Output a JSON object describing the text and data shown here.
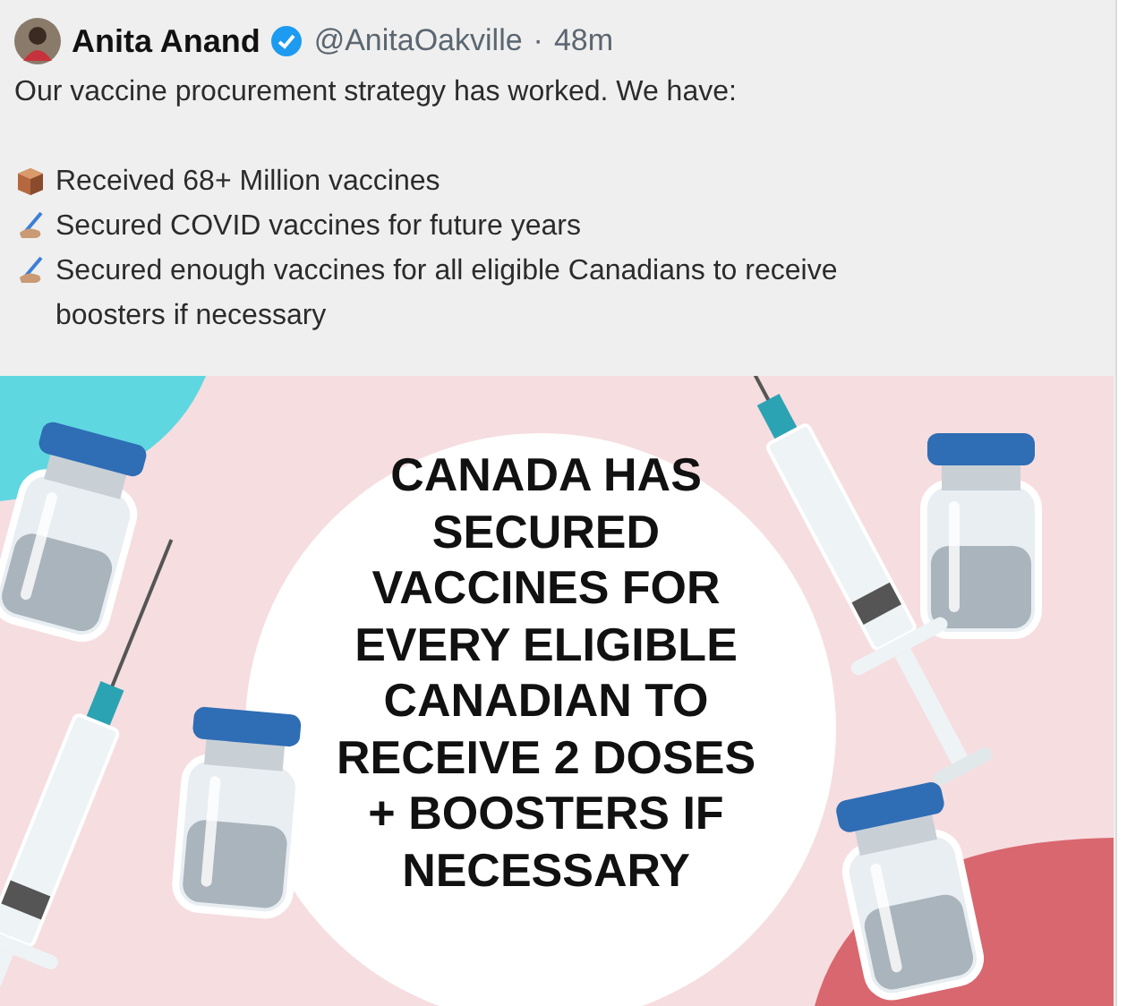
{
  "tweet": {
    "author": "Anita Anand",
    "verified": true,
    "handle": "@AnitaOakville",
    "separator": "·",
    "time": "48m",
    "intro": "Our vaccine procurement strategy has worked. We have:",
    "points": [
      {
        "kind": "package",
        "text": "Received 68+ Million vaccines"
      },
      {
        "kind": "writing",
        "text": "Secured COVID vaccines for future years"
      },
      {
        "kind": "writing",
        "text": "Secured enough vaccines for all eligible Canadians to receive boosters if necessary"
      }
    ],
    "image": {
      "kind": "picture",
      "headline": [
        "CANADA HAS",
        "SECURED",
        "VACCINES FOR",
        "EVERY ELIGIBLE",
        "CANADIAN TO",
        "RECEIVE 2 DOSES",
        "+ BOOSTERS IF",
        "NECESSARY"
      ]
    }
  }
}
